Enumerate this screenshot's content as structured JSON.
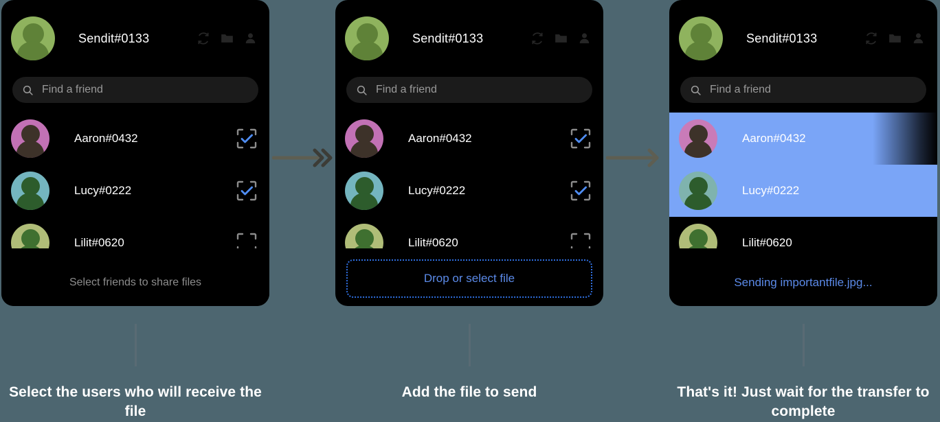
{
  "background_color": "#4d6670",
  "panel_bg": "#000000",
  "accent_blue": "#5b8ae8",
  "selection_blue": "#7aa5f7",
  "header": {
    "account_name": "Sendit#0133",
    "avatar_color": "#8fb35e",
    "avatar_figure_color": "#5f8238",
    "icons": [
      {
        "name": "refresh-icon",
        "label": "Refresh"
      },
      {
        "name": "folder-icon",
        "label": "Folder"
      },
      {
        "name": "account-icon",
        "label": "Account"
      }
    ]
  },
  "search": {
    "placeholder": "Find a friend",
    "value": "",
    "icon": "search-icon"
  },
  "friends": [
    {
      "name": "Aaron#0432",
      "avatar_color": "#c271b5",
      "avatar_figure_color": "#3d3229",
      "checked": true
    },
    {
      "name": "Lucy#0222",
      "avatar_color": "#74b5bf",
      "avatar_figure_color": "#2d5c2c",
      "checked": true
    },
    {
      "name": "Lilit#0620",
      "avatar_color": "#b0bd78",
      "avatar_figure_color": "#3f7030",
      "checked": false
    }
  ],
  "friends_selected": [
    {
      "name": "Aaron#0432",
      "avatar_color": "#c97bb8",
      "avatar_figure_color": "#3d3229",
      "selected": true,
      "progress_percent": 76
    },
    {
      "name": "Lucy#0222",
      "avatar_color": "#7fb3ae",
      "avatar_figure_color": "#2d5c2c",
      "selected": true,
      "progress_percent": 100
    },
    {
      "name": "Lilit#0620",
      "avatar_color": "#b0bd78",
      "avatar_figure_color": "#3f7030",
      "selected": false,
      "progress_percent": 0
    }
  ],
  "panels": [
    {
      "id": "step-1",
      "footer_hint": "Select friends to share files"
    },
    {
      "id": "step-2",
      "dropzone_label": "Drop or select file"
    },
    {
      "id": "step-3",
      "status_text": "Sending importantfile.jpg..."
    }
  ],
  "captions": [
    "Select the users who will receive the file",
    "Add the file to send",
    "That's it! Just wait for the transfer to complete"
  ]
}
